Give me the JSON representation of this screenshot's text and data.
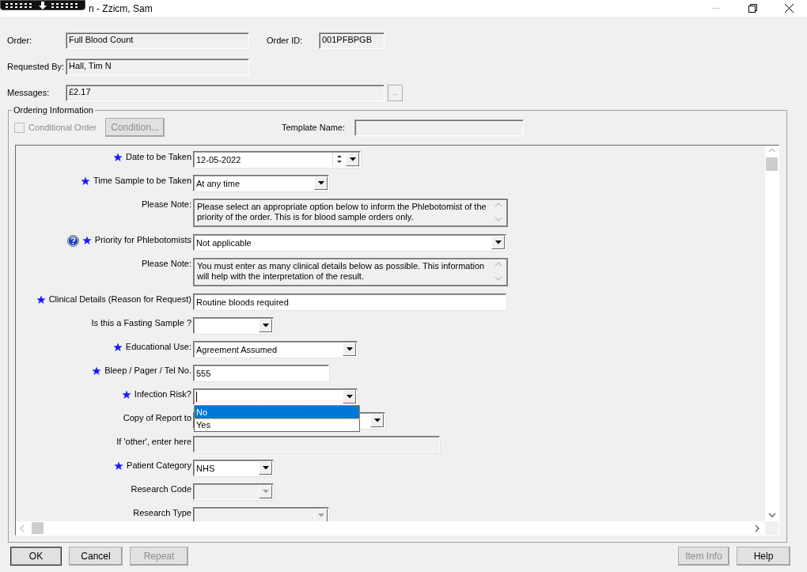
{
  "window": {
    "title": "n - Zzicm, Sam"
  },
  "header": {
    "order": {
      "label": "Order:",
      "value": "Full Blood Count"
    },
    "order_id": {
      "label": "Order ID:",
      "value": "001PFBPGB"
    },
    "requested_by": {
      "label": "Requested By:",
      "value": "Hall, Tim N"
    },
    "messages": {
      "label": "Messages:",
      "value": "£2.17",
      "button": "..."
    }
  },
  "ordering": {
    "title": "Ordering Information",
    "conditional_order": {
      "label": "Conditional Order",
      "checked": false,
      "disabled": true
    },
    "condition_button": {
      "label": "Condition...",
      "disabled": true
    },
    "template_name": {
      "label": "Template Name:"
    },
    "rows": [
      {
        "kind": "date",
        "label": "Date to be Taken",
        "required": true,
        "help": false,
        "value": "12-05-2022"
      },
      {
        "kind": "dropdown",
        "label": "Time Sample to be Taken",
        "required": true,
        "help": false,
        "value": "At any time"
      },
      {
        "kind": "note",
        "label": "Please Note:",
        "text": "Please select an appropriate option below to inform the Phlebotomist of the priority of the order. This is for blood sample orders only."
      },
      {
        "kind": "dropdown",
        "label": "Priority for Phlebotomists",
        "required": true,
        "help": true,
        "value": "Not applicable"
      },
      {
        "kind": "note",
        "label": "Please Note:",
        "text": "You must enter as many clinical details below as possible.  This information will help with the interpretation of the result."
      },
      {
        "kind": "text",
        "label": "Clinical Details (Reason for Request)",
        "required": true,
        "help": false,
        "value": "Routine bloods required"
      },
      {
        "kind": "dropdown",
        "label": "Is this a Fasting Sample ?",
        "required": false,
        "help": false
      },
      {
        "kind": "dropdown",
        "label": "Educational Use:",
        "required": true,
        "help": false,
        "value": "Agreement Assumed"
      },
      {
        "kind": "text",
        "label": "Bleep / Pager / Tel No.",
        "required": true,
        "help": false,
        "value": "555"
      },
      {
        "kind": "dropdown",
        "label": "Infection Risk?",
        "required": true,
        "help": false,
        "focused": true,
        "options": [
          {
            "label": "No",
            "selected": true
          },
          {
            "label": "Yes",
            "selected": false
          }
        ]
      },
      {
        "kind": "dropdown",
        "label": "Copy of Report to",
        "required": false,
        "help": false
      },
      {
        "kind": "text",
        "label": "If 'other', enter here",
        "required": false,
        "help": false,
        "disabled": true
      },
      {
        "kind": "dropdown",
        "label": "Patient Category",
        "required": true,
        "help": false,
        "value": "NHS"
      },
      {
        "kind": "dropdown",
        "label": "Research Code",
        "required": false,
        "help": false,
        "disabled": true
      },
      {
        "kind": "dropdown",
        "label": "Research Type",
        "required": false,
        "help": false,
        "disabled": true
      }
    ]
  },
  "buttons": [
    {
      "label": "OK",
      "disabled": false,
      "default": true
    },
    {
      "label": "Cancel",
      "disabled": false,
      "default": false
    },
    {
      "label": "Repeat",
      "disabled": true,
      "default": false
    },
    {
      "label": "Item Info",
      "disabled": true,
      "default": false
    },
    {
      "label": "Help",
      "disabled": false,
      "default": false
    }
  ]
}
